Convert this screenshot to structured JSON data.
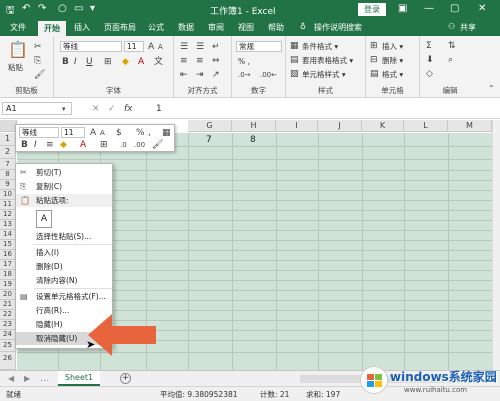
{
  "titlebar": {
    "title": "工作簿1 - Excel",
    "login_label": "登录",
    "minimize": "—",
    "restore": "▢",
    "close": "✕"
  },
  "tabs": [
    "文件",
    "开始",
    "插入",
    "页面布局",
    "公式",
    "数据",
    "审阅",
    "视图",
    "帮助"
  ],
  "tell_me": "操作说明搜索",
  "share_label": "共享",
  "ribbon": {
    "clipboard": {
      "paste": "粘贴",
      "label": "剪贴板"
    },
    "font": {
      "name": "等线",
      "size": "11",
      "label": "字体"
    },
    "alignment": {
      "label": "对齐方式"
    },
    "number": {
      "format": "常规",
      "percent": "% ,",
      "label": "数字"
    },
    "styles": {
      "cond": "条件格式 ▾",
      "table": "套用表格格式 ▾",
      "cell": "单元格样式 ▾",
      "label": "样式"
    },
    "cells": {
      "insert": "插入 ▾",
      "delete": "删除 ▾",
      "format": "格式 ▾",
      "label": "单元格"
    },
    "editing": {
      "label": "编辑"
    }
  },
  "formula_bar": {
    "name_box": "A1",
    "cancel": "✕",
    "enter": "✓",
    "fx": "fx",
    "content": "1"
  },
  "columns": [
    "G",
    "H",
    "I",
    "J",
    "K",
    "L",
    "M"
  ],
  "visible_rows": [
    "1",
    "2",
    "7",
    "8",
    "9",
    "10",
    "11",
    "12",
    "13",
    "14",
    "15",
    "16",
    "17",
    "18",
    "19",
    "20",
    "21",
    "22",
    "23",
    "24",
    "25",
    "26"
  ],
  "cell_values": {
    "g1": "7",
    "h1": "8"
  },
  "mini_toolbar": {
    "font": "等线",
    "size": "11",
    "bold": "B",
    "italic": "I"
  },
  "context_menu": [
    {
      "label": "剪切(T)",
      "icon": "scissors-icon"
    },
    {
      "label": "复制(C)",
      "icon": "copy-icon"
    },
    {
      "label": "粘贴选项:",
      "icon": "paste-icon"
    },
    {
      "label": "选择性粘贴(S)...",
      "icon": ""
    },
    {
      "label": "插入(I)",
      "icon": ""
    },
    {
      "label": "删除(D)",
      "icon": ""
    },
    {
      "label": "清除内容(N)",
      "icon": ""
    },
    {
      "label": "设置单元格格式(F)...",
      "icon": "format-cells-icon"
    },
    {
      "label": "行高(R)...",
      "icon": ""
    },
    {
      "label": "隐藏(H)",
      "icon": ""
    },
    {
      "label": "取消隐藏(U)",
      "icon": ""
    }
  ],
  "sheet_tab": "Sheet1",
  "add_sheet": "+",
  "status": {
    "ready": "就绪",
    "average": "平均值: 9.380952381",
    "count": "计数: 21",
    "sum": "求和: 197"
  },
  "watermark": {
    "brand": "windows系统家园",
    "url": "www.ruihaitu.com"
  },
  "colors": {
    "accent": "#217346",
    "selection": "#cfe3d6",
    "arrow": "#e8643c"
  }
}
